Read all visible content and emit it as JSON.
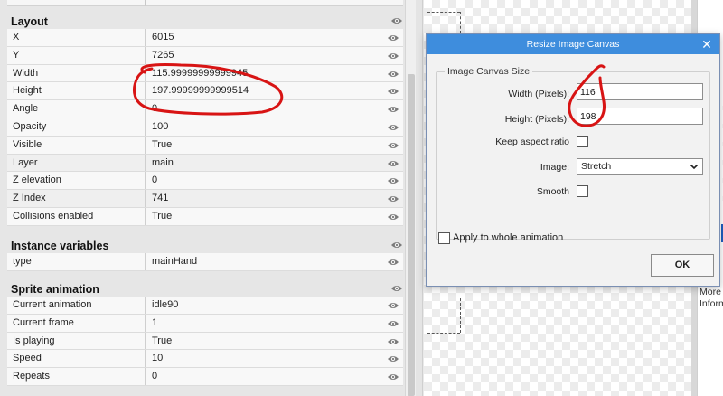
{
  "sections": {
    "layout": {
      "title": "Layout",
      "rows": [
        {
          "key": "X",
          "value": "6015"
        },
        {
          "key": "Y",
          "value": "7265"
        },
        {
          "key": "Width",
          "value": "115.99999999999945"
        },
        {
          "key": "Height",
          "value": "197.99999999999514"
        },
        {
          "key": "Angle",
          "value": "0"
        },
        {
          "key": "Opacity",
          "value": "100"
        },
        {
          "key": "Visible",
          "value": "True"
        },
        {
          "key": "Layer",
          "value": "main"
        },
        {
          "key": "Z elevation",
          "value": "0"
        },
        {
          "key": "Z Index",
          "value": "741"
        },
        {
          "key": "Collisions enabled",
          "value": "True"
        }
      ]
    },
    "instance_variables": {
      "title": "Instance variables",
      "rows": [
        {
          "key": "type",
          "value": "mainHand"
        }
      ]
    },
    "sprite_animation": {
      "title": "Sprite animation",
      "rows": [
        {
          "key": "Current animation",
          "value": "idle90"
        },
        {
          "key": "Current frame",
          "value": "1"
        },
        {
          "key": "Is playing",
          "value": "True"
        },
        {
          "key": "Speed",
          "value": "10"
        },
        {
          "key": "Repeats",
          "value": "0"
        }
      ]
    }
  },
  "dialog": {
    "title": "Resize Image Canvas",
    "group_label": "Image Canvas Size",
    "width_label": "Width (Pixels):",
    "width_value": "116",
    "height_label": "Height (Pixels):",
    "height_value": "198",
    "keep_aspect_label": "Keep aspect ratio",
    "keep_aspect_checked": false,
    "image_label": "Image:",
    "image_value": "Stretch",
    "smooth_label": "Smooth",
    "smooth_checked": false,
    "apply_label": "Apply to whole animation",
    "apply_checked": false,
    "ok_label": "OK"
  },
  "right_panel": {
    "more_line1": "More",
    "more_line2": "Inform"
  },
  "colors": {
    "titlebar": "#3e8ddd",
    "annotation": "#d81414",
    "accent_blue": "#1f5fbf"
  },
  "icons": {
    "row_toggle": "eye-icon",
    "dialog_close": "close-icon",
    "select_arrow": "chevron-down-icon"
  }
}
